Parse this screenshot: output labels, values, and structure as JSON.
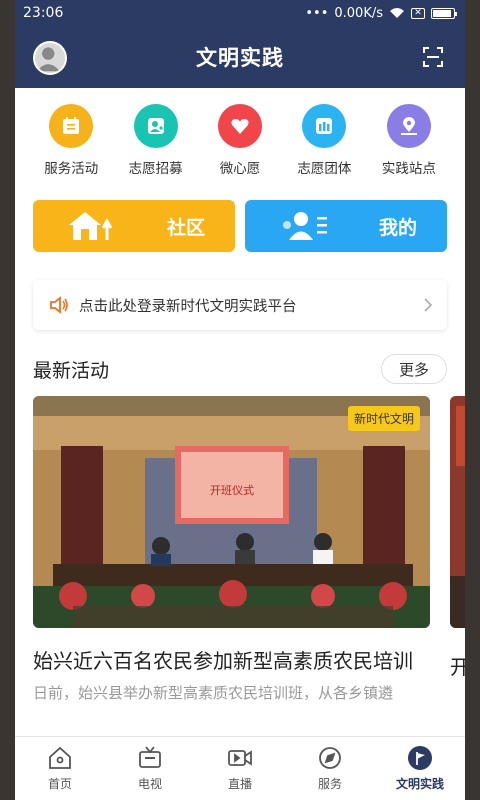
{
  "status": {
    "time": "23:06",
    "network_speed": "0.00K/s",
    "battery_percent": 90
  },
  "header": {
    "title": "文明实践",
    "scan_icon": "scan-icon",
    "avatar_icon": "avatar"
  },
  "nav": [
    {
      "label": "服务活动",
      "color": "#f6b21b",
      "icon": "calendar-icon"
    },
    {
      "label": "志愿招募",
      "color": "#19c4b3",
      "icon": "volunteer-icon"
    },
    {
      "label": "微心愿",
      "color": "#f0464b",
      "icon": "heart-icon"
    },
    {
      "label": "志愿团体",
      "color": "#2cb4f0",
      "icon": "group-icon"
    },
    {
      "label": "实践站点",
      "color": "#8a7de6",
      "icon": "location-icon"
    }
  ],
  "banners": {
    "community": "社区",
    "mine": "我的"
  },
  "notice": {
    "text": "点击此处登录新时代文明实践平台"
  },
  "section": {
    "title": "最新活动",
    "more": "更多"
  },
  "article": {
    "tag": "新时代文明",
    "title": "始兴近六百名农民参加新型高素质农民培训",
    "summary": "日前，始兴县举办新型高素质农民培训班，从各乡镇遴",
    "next_title": "开动",
    "screen_text": "开班仪式"
  },
  "tabs": [
    {
      "label": "首页",
      "icon": "home-icon"
    },
    {
      "label": "电视",
      "icon": "tv-icon"
    },
    {
      "label": "直播",
      "icon": "live-icon"
    },
    {
      "label": "服务",
      "icon": "compass-icon"
    },
    {
      "label": "文明实践",
      "icon": "flag-icon",
      "active": true
    }
  ]
}
